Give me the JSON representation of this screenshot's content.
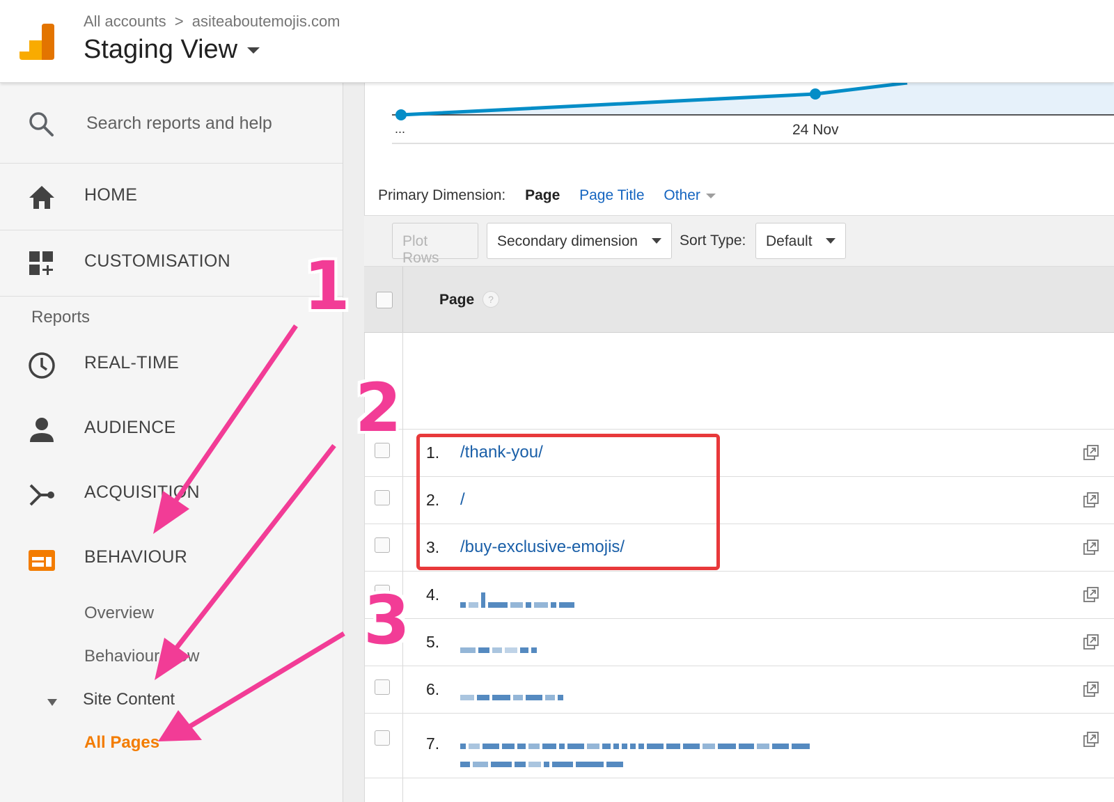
{
  "header": {
    "breadcrumb_root": "All accounts",
    "breadcrumb_sep": ">",
    "breadcrumb_site": "asiteaboutemojis.com",
    "view_title": "Staging View"
  },
  "sidebar": {
    "search_placeholder": "Search reports and help",
    "home": "HOME",
    "customisation": "CUSTOMISATION",
    "reports_section": "Reports",
    "realtime": "REAL-TIME",
    "audience": "AUDIENCE",
    "acquisition": "ACQUISITION",
    "behaviour": "BEHAVIOUR",
    "overview": "Overview",
    "behaviour_flow": "Behaviour Flow",
    "site_content": "Site Content",
    "all_pages": "All Pages"
  },
  "chart": {
    "x_left_label": "...",
    "x_mid_label": "24 Nov",
    "line_color": "#058dc7"
  },
  "dimensions": {
    "label": "Primary Dimension:",
    "current": "Page",
    "page_title": "Page Title",
    "other": "Other"
  },
  "toolbar": {
    "plot_rows": "Plot Rows",
    "secondary_dimension": "Secondary dimension",
    "sort_type_label": "Sort Type:",
    "sort_default": "Default"
  },
  "table": {
    "column_header": "Page",
    "help_symbol": "?",
    "rows": [
      {
        "num": "1.",
        "page": "/thank-you/"
      },
      {
        "num": "2.",
        "page": "/"
      },
      {
        "num": "3.",
        "page": "/buy-exclusive-emojis/"
      },
      {
        "num": "4.",
        "page": ""
      },
      {
        "num": "5.",
        "page": ""
      },
      {
        "num": "6.",
        "page": ""
      },
      {
        "num": "7.",
        "page": ""
      }
    ]
  },
  "annotations": {
    "step1": "1",
    "step2": "2",
    "step3": "3",
    "arrow_color": "#f23c96",
    "box_color": "#e8393b"
  },
  "colors": {
    "accent_orange": "#f37c00",
    "link_blue": "#1a5fa8"
  }
}
